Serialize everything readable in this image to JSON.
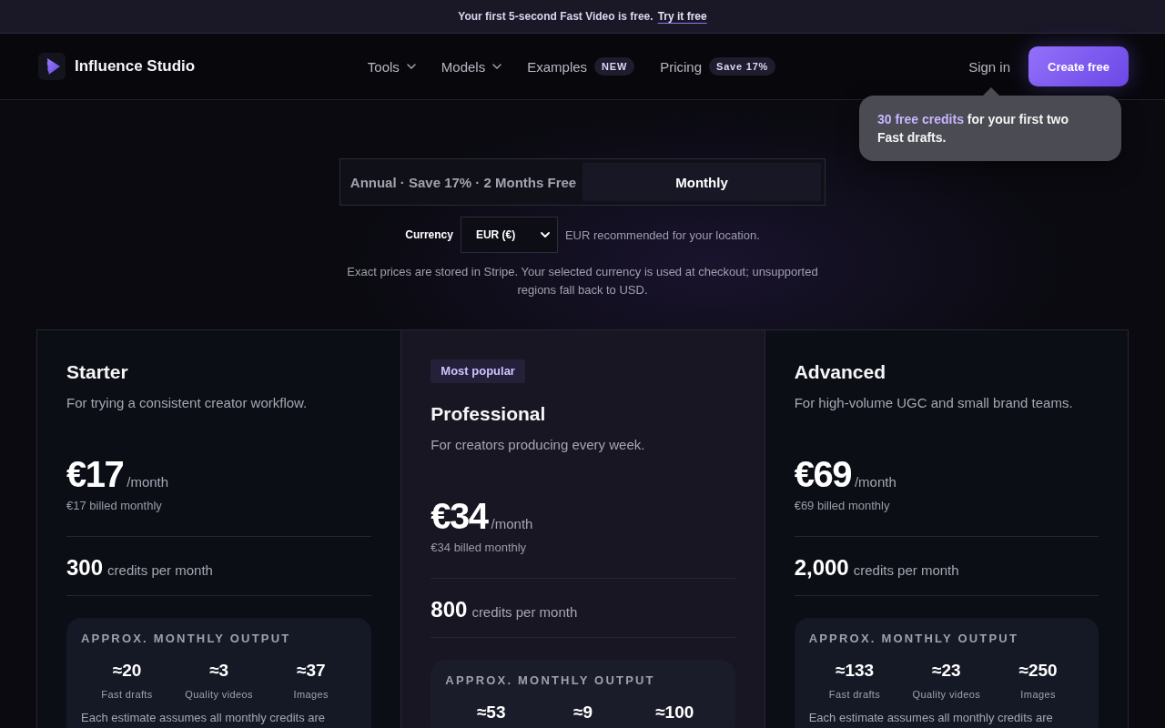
{
  "banner": {
    "text": "Your first 5-second Fast Video is free.",
    "link": "Try it free"
  },
  "header": {
    "brand": "Influence Studio",
    "nav": [
      {
        "label": "Tools",
        "kind": "dropdown"
      },
      {
        "label": "Models",
        "kind": "dropdown"
      },
      {
        "label": "Examples",
        "kind": "badge",
        "badge": "NEW"
      },
      {
        "label": "Pricing",
        "kind": "badge",
        "badge": "Save 17%"
      }
    ],
    "sign_in": "Sign in",
    "cta": "Create free"
  },
  "tooltip": {
    "text": "**30 free credits** for your first two Fast drafts."
  },
  "billing_tabs": [
    {
      "label": "Annual · Save 17% · 2 Months Free",
      "selected": false
    },
    {
      "label": "Monthly",
      "selected": true
    }
  ],
  "currency": {
    "label": "Currency",
    "value": "EUR (€)",
    "hint": "EUR recommended for your location."
  },
  "note": "Exact prices are stored in Stripe. Your selected currency is used at checkout; unsupported regions fall back to USD.",
  "plans": [
    {
      "name": "Starter",
      "highlighted": false,
      "description": "For trying a consistent creator workflow.",
      "price": "€17",
      "period": "/month",
      "billed": "€17 billed monthly",
      "credits": "300",
      "credits_label": "credits per month",
      "output": {
        "title": "APPROX. MONTHLY OUTPUT",
        "stats": [
          {
            "value": "≈20",
            "label": "Fast drafts"
          },
          {
            "value": "≈3",
            "label": "Quality videos"
          },
          {
            "value": "≈37",
            "label": "Images"
          }
        ],
        "footnote": "Each estimate assumes all monthly credits are"
      }
    },
    {
      "name": "Professional",
      "badge": "Most popular",
      "highlighted": true,
      "description": "For creators producing every week.",
      "price": "€34",
      "period": "/month",
      "billed": "€34 billed monthly",
      "credits": "800",
      "credits_label": "credits per month",
      "output": {
        "title": "APPROX. MONTHLY OUTPUT",
        "stats": [
          {
            "value": "≈53"
          },
          {
            "value": "≈9"
          },
          {
            "value": "≈100"
          }
        ]
      }
    },
    {
      "name": "Advanced",
      "highlighted": false,
      "description": "For high-volume UGC and small brand teams.",
      "price": "€69",
      "period": "/month",
      "billed": "€69 billed monthly",
      "credits": "2,000",
      "credits_label": "credits per month",
      "output": {
        "title": "APPROX. MONTHLY OUTPUT",
        "stats": [
          {
            "value": "≈133",
            "label": "Fast drafts"
          },
          {
            "value": "≈23",
            "label": "Quality videos"
          },
          {
            "value": "≈250",
            "label": "Images"
          }
        ],
        "footnote": "Each estimate assumes all monthly credits are"
      }
    }
  ]
}
